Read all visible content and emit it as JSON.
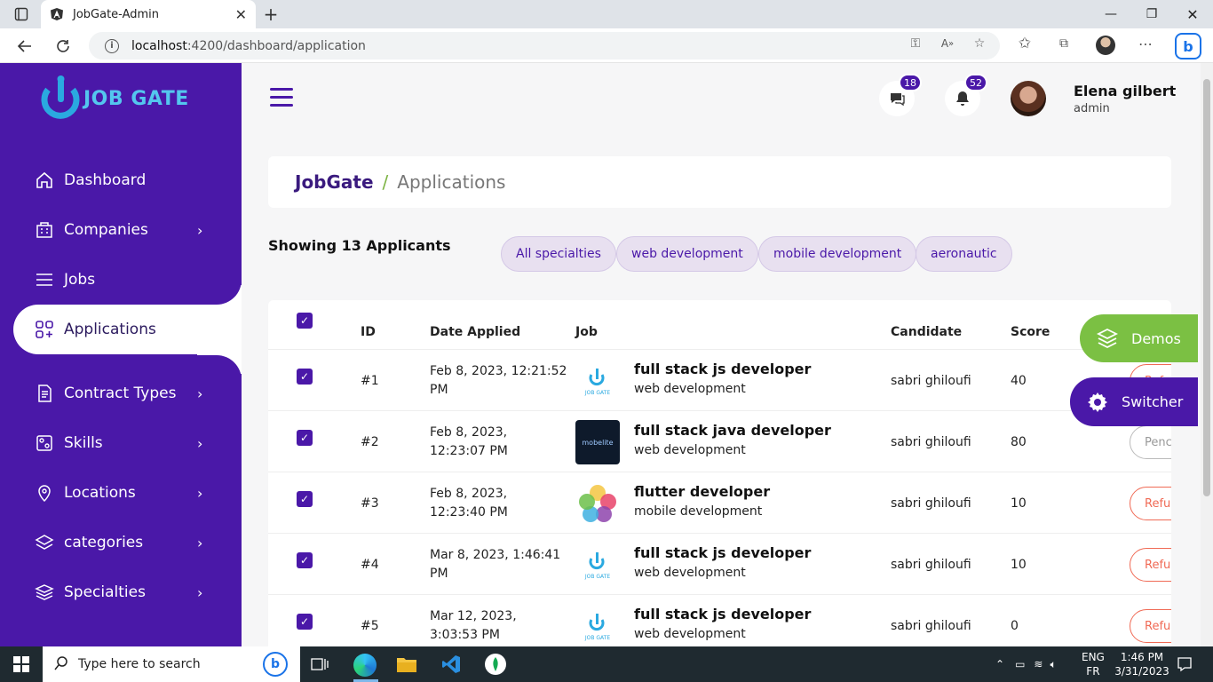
{
  "browser": {
    "tab_title": "JobGate-Admin",
    "url_host": "localhost",
    "url_path": ":4200/dashboard/application"
  },
  "brand": {
    "logo_text": "JOB GATE",
    "primary": "#4a18a8",
    "accent": "#7bc043",
    "danger": "#f06a55"
  },
  "sidebar": {
    "items": [
      {
        "label": "Dashboard",
        "icon": "home-icon",
        "has_chevron": false
      },
      {
        "label": "Companies",
        "icon": "building-icon",
        "has_chevron": true
      },
      {
        "label": "Jobs",
        "icon": "list-icon",
        "has_chevron": true
      },
      {
        "label": "Applications",
        "icon": "apps-plus-icon",
        "has_chevron": false,
        "active": true
      },
      {
        "label": "Contract Types",
        "icon": "document-icon",
        "has_chevron": true
      },
      {
        "label": "Skills",
        "icon": "skills-icon",
        "has_chevron": true
      },
      {
        "label": "Locations",
        "icon": "location-pin-icon",
        "has_chevron": true
      },
      {
        "label": "categories",
        "icon": "layers-icon",
        "has_chevron": true
      },
      {
        "label": "Specialties",
        "icon": "stack-icon",
        "has_chevron": true
      }
    ]
  },
  "header": {
    "messages_count": "18",
    "notifications_count": "52",
    "user_name": "Elena gilbert",
    "user_role": "admin"
  },
  "breadcrumb": {
    "home": "JobGate",
    "separator": "/",
    "current": "Applications"
  },
  "filters": {
    "showing": "Showing 13 Applicants",
    "chips": [
      "All specialties",
      "web development",
      "mobile development",
      "aeronautic"
    ]
  },
  "table": {
    "headers": {
      "id": "ID",
      "date": "Date Applied",
      "job": "Job",
      "candidate": "Candidate",
      "score": "Score"
    },
    "rows": [
      {
        "id": "#1",
        "date_line1": "Feb 8, 2023, 12:21:52",
        "date_line2": "PM",
        "job_title": "full stack js developer",
        "job_spec": "web development",
        "candidate": "sabri ghiloufi",
        "score": "40",
        "status": "Refu",
        "logo": "jobgate"
      },
      {
        "id": "#2",
        "date_line1": "Feb 8, 2023,",
        "date_line2": "12:23:07 PM",
        "job_title": "full stack java developer",
        "job_spec": "web development",
        "candidate": "sabri ghiloufi",
        "score": "80",
        "status": "Penc",
        "logo": "mobelite"
      },
      {
        "id": "#3",
        "date_line1": "Feb 8, 2023,",
        "date_line2": "12:23:40 PM",
        "job_title": "flutter developer",
        "job_spec": "mobile development",
        "candidate": "sabri ghiloufi",
        "score": "10",
        "status": "Refu",
        "logo": "flower"
      },
      {
        "id": "#4",
        "date_line1": "Mar 8, 2023, 1:46:41",
        "date_line2": "PM",
        "job_title": "full stack js developer",
        "job_spec": "web development",
        "candidate": "sabri ghiloufi",
        "score": "10",
        "status": "Refu",
        "logo": "jobgate"
      },
      {
        "id": "#5",
        "date_line1": "Mar 12, 2023,",
        "date_line2": "3:03:53 PM",
        "job_title": "full stack js developer",
        "job_spec": "web development",
        "candidate": "sabri ghiloufi",
        "score": "0",
        "status": "Refu",
        "logo": "jobgate"
      }
    ]
  },
  "floating": {
    "demos": "Demos",
    "switcher": "Switcher"
  },
  "taskbar": {
    "search_placeholder": "Type here to search",
    "lang_top": "ENG",
    "lang_bottom": "FR",
    "time": "1:46 PM",
    "date": "3/31/2023"
  }
}
